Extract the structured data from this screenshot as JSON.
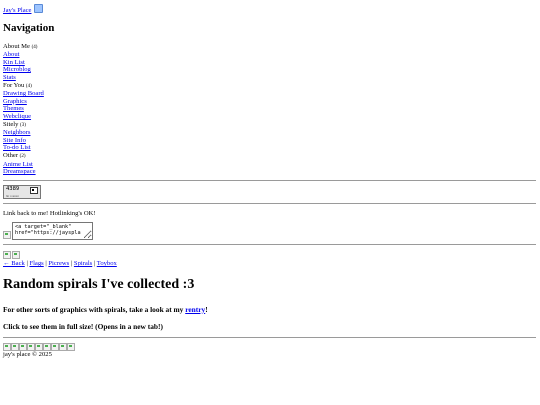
{
  "site": {
    "title": "Jay's Place",
    "icon": "emoji-icon"
  },
  "nav": {
    "heading": "Navigation",
    "groups": [
      {
        "label": "About Me",
        "count": "(4)",
        "links": [
          "About",
          "Kin List",
          "Microblog",
          "Stats"
        ]
      },
      {
        "label": "For You",
        "count": "(4)",
        "links": [
          "Drawing Board",
          "Graphics",
          "Themes",
          "Webclique"
        ]
      },
      {
        "label": "Sitely",
        "count": "(3)",
        "links": [
          "Neighbors",
          "Site Info",
          "To-do List"
        ]
      },
      {
        "label": "Other",
        "count": "(2)",
        "links": [
          "Anime List",
          "Dreamspace"
        ]
      }
    ]
  },
  "counter": {
    "value": "4389",
    "caption": "hit counter"
  },
  "linkback": {
    "text": "Link back to me! Hotlinking's OK!",
    "code": "<a target=\"_blank\"\nhref=\"https://jayspla"
  },
  "subnav": {
    "back": "← Back",
    "links": [
      "Flags",
      "Picrews",
      "Spirals",
      "Toybox"
    ],
    "separator": "|"
  },
  "page": {
    "title": "Random spirals I've collected :3",
    "other_prefix": "For other sorts of graphics with spirals, take a look at my ",
    "other_link": "rentry",
    "other_suffix": "!",
    "click_note": "Click to see them in full size! (Opens in a new tab!)"
  },
  "thumbnails": {
    "count": 9
  },
  "footer": {
    "text": "jay's place © 2025"
  }
}
